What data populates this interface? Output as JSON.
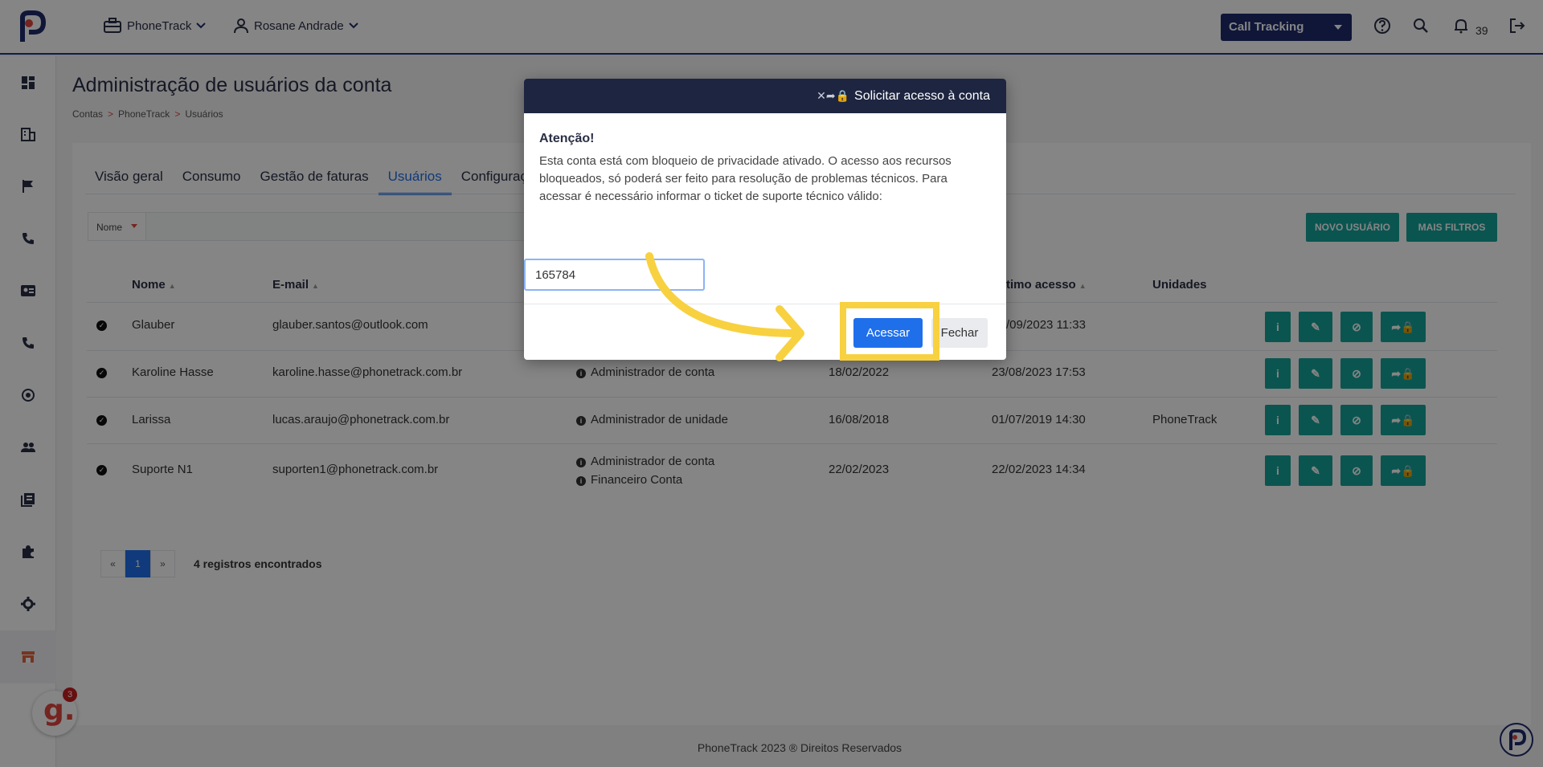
{
  "topbar": {
    "company": "PhoneTrack",
    "user": "Rosane Andrade",
    "product": "Call Tracking",
    "notifications": "39"
  },
  "page": {
    "title": "Administração de usuários da conta",
    "breadcrumb": [
      "Contas",
      "PhoneTrack",
      "Usuários"
    ]
  },
  "tabs": [
    "Visão geral",
    "Consumo",
    "Gestão de faturas",
    "Usuários",
    "Configuraç"
  ],
  "filter": {
    "field": "Nome"
  },
  "buttons": {
    "new_user": "NOVO USUÁRIO",
    "more_filters": "MAIS FILTROS"
  },
  "table": {
    "headers": [
      "Nome",
      "E-mail",
      "timo acesso",
      "Unidades"
    ],
    "rows": [
      {
        "name": "Glauber",
        "email": "glauber.santos@outlook.com",
        "profiles": [],
        "created": "",
        "last_access": "/09/2023 11:33",
        "units": ""
      },
      {
        "name": "Karoline Hasse",
        "email": "karoline.hasse@phonetrack.com.br",
        "profiles": [
          "Administrador de conta"
        ],
        "created": "18/02/2022",
        "last_access": "23/08/2023 17:53",
        "units": ""
      },
      {
        "name": "Larissa",
        "email": "lucas.araujo@phonetrack.com.br",
        "profiles": [
          "Administrador de unidade"
        ],
        "created": "16/08/2018",
        "last_access": "01/07/2019 14:30",
        "units": "PhoneTrack"
      },
      {
        "name": "Suporte N1",
        "email": "suporten1@phonetrack.com.br",
        "profiles": [
          "Administrador de conta",
          "Financeiro Conta"
        ],
        "created": "22/02/2023",
        "last_access": "22/02/2023 14:34",
        "units": ""
      }
    ]
  },
  "pager": {
    "prev": "«",
    "current": "1",
    "next": "»",
    "records": "4 registros encontrados"
  },
  "footer": "PhoneTrack 2023 ® Direitos Reservados",
  "widget": {
    "count": "3"
  },
  "modal": {
    "title": "Solicitar acesso à conta",
    "heading": "Atenção!",
    "message": "Esta conta está com bloqueio de privacidade ativado. O acesso aos recursos bloqueados, só poderá ser feito para resolução de problemas técnicos. Para acessar é necessário informar o ticket de suporte técnico válido:",
    "ticket_value": "165784",
    "confirm": "Acessar",
    "close": "Fechar"
  },
  "colors": {
    "teal": "#16a39a",
    "navy": "#1d2b6b",
    "primary": "#1f6feb",
    "highlight": "#f8d140"
  }
}
